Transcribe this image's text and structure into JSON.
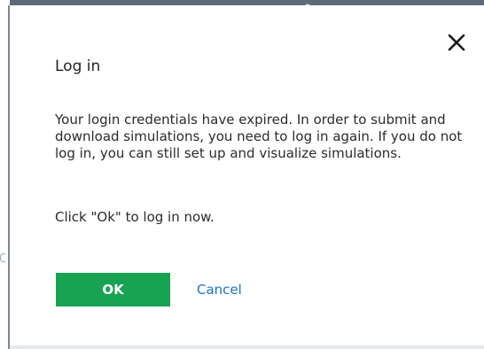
{
  "dialog": {
    "title": "Log in",
    "message": "Your login credentials have expired. In order to submit and download simulations, you need to log in again. If you do not log in, you can still set up and visualize simulations.",
    "instruction": "Click \"Ok\" to log in now.",
    "ok_label": "OK",
    "cancel_label": "Cancel",
    "close_icon": "close-icon"
  },
  "colors": {
    "accent": "#17a352",
    "link": "#1f6fd6",
    "text": "#2b2b2b"
  }
}
